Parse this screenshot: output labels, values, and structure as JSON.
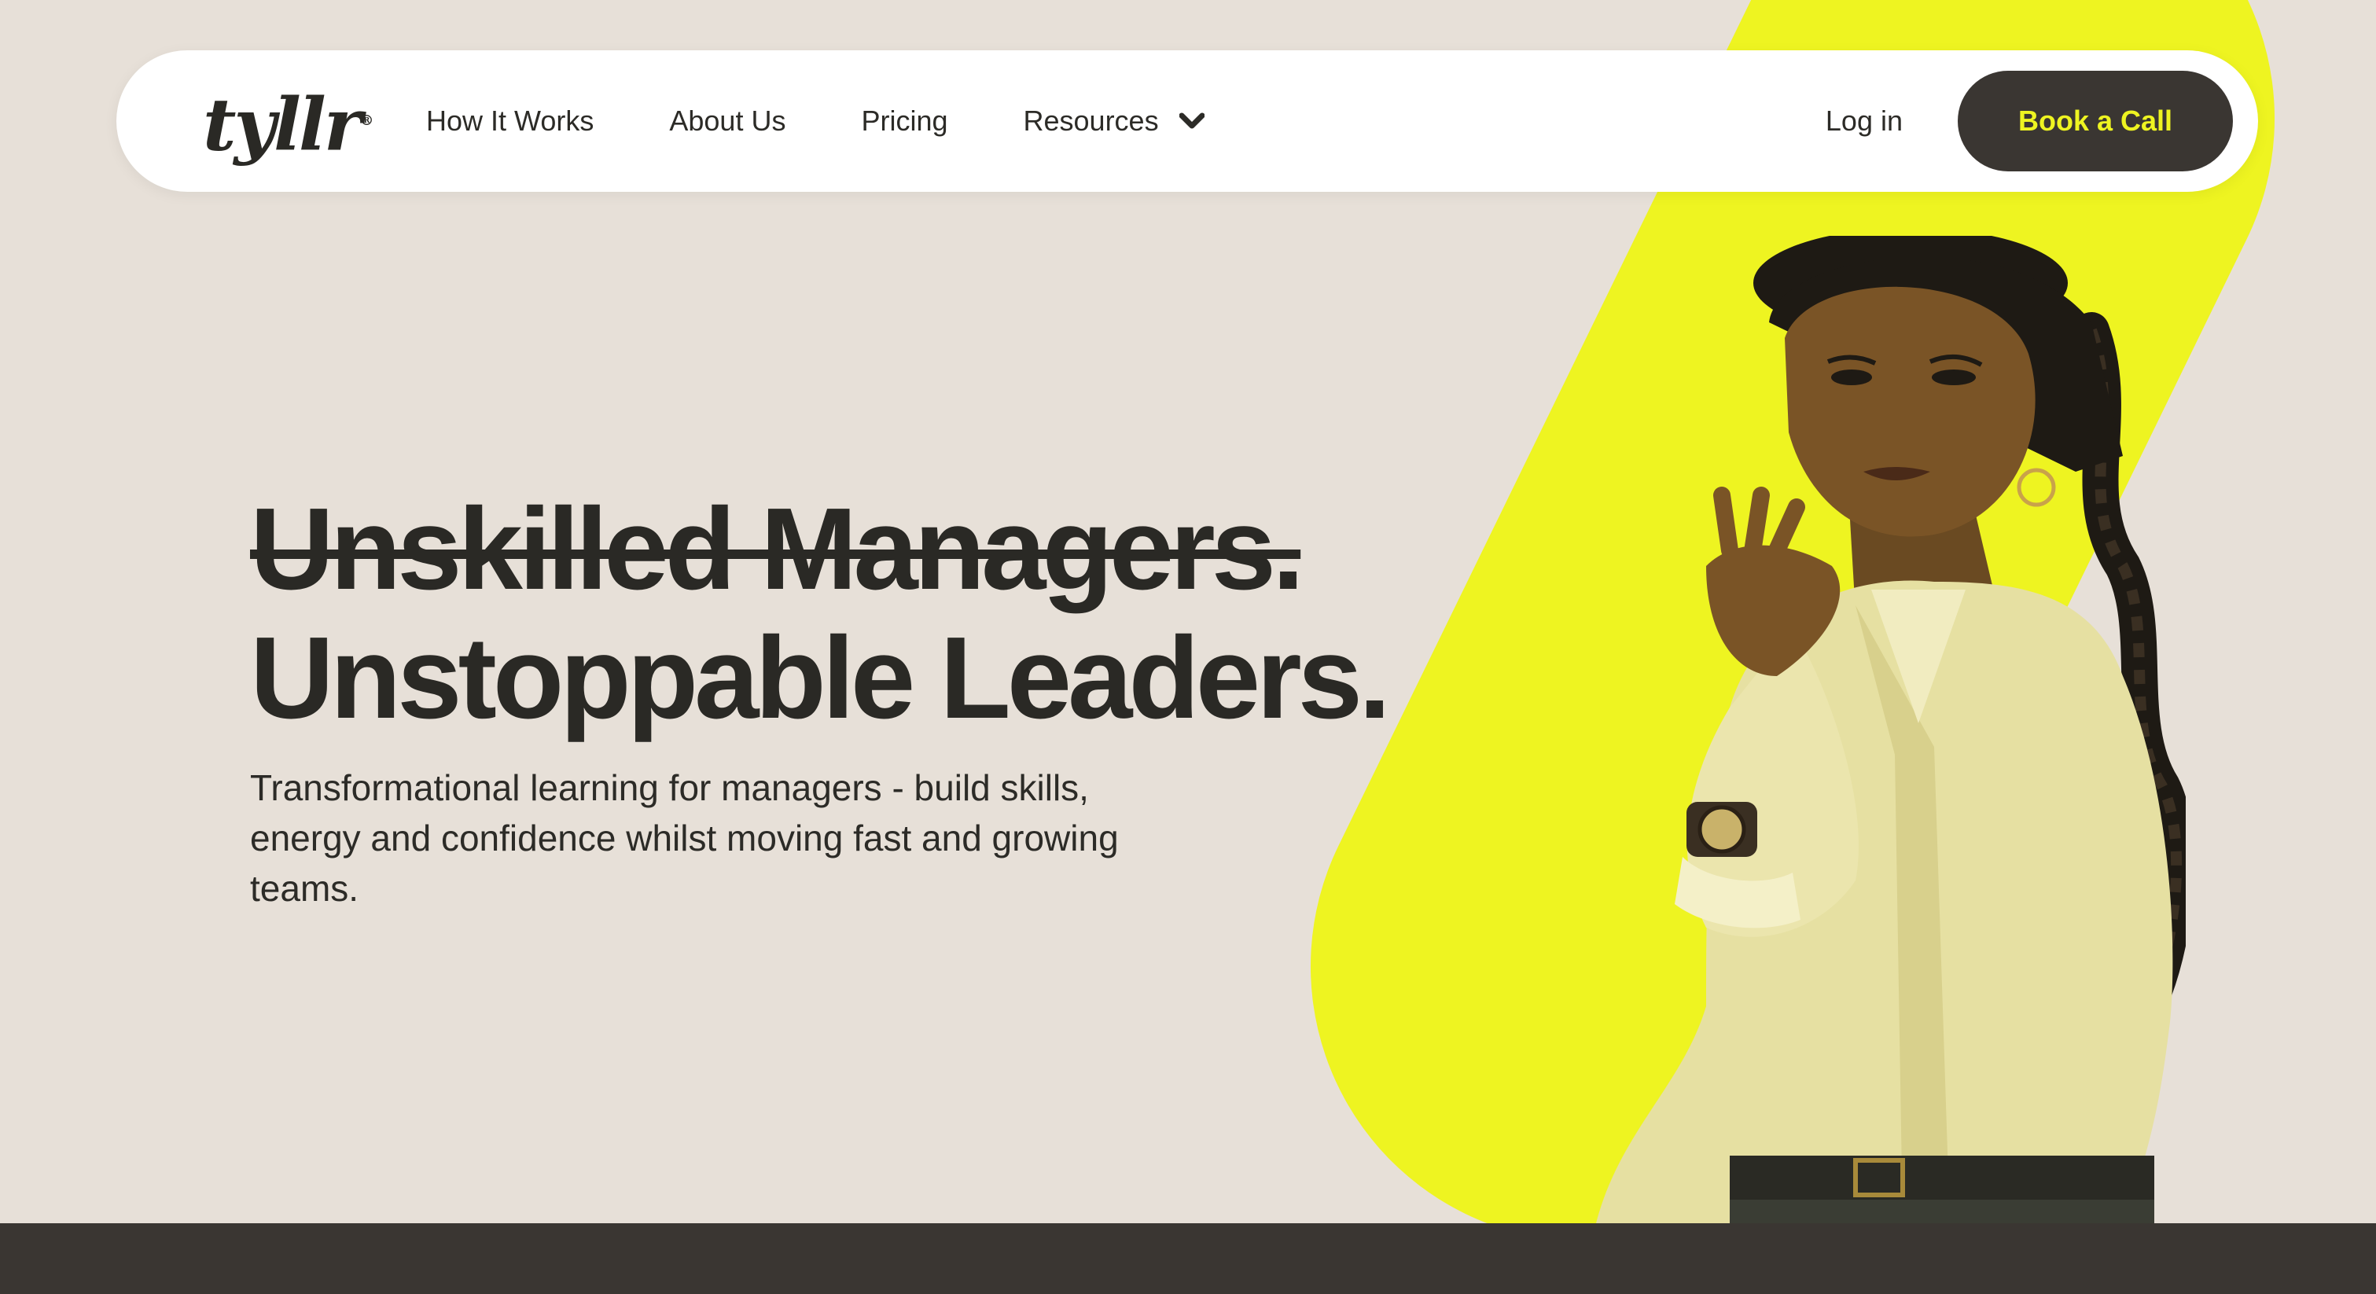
{
  "brand": {
    "logo_text": "tyllr",
    "logo_mark": "®",
    "accent_color": "#eef421",
    "dark_color": "#3a3632",
    "bg_color": "#e7e0d8"
  },
  "nav": {
    "links": [
      {
        "label": "How It Works"
      },
      {
        "label": "About Us"
      },
      {
        "label": "Pricing"
      },
      {
        "label": "Resources",
        "icon": "chevron-down-icon"
      }
    ],
    "login_label": "Log in",
    "cta_label": "Book a Call"
  },
  "hero": {
    "struck_line": "Unskilled Managers.",
    "headline": "Unstoppable Leaders.",
    "subtext": "Transformational learning for managers - build skills, energy and confidence whilst moving fast and growing teams."
  }
}
